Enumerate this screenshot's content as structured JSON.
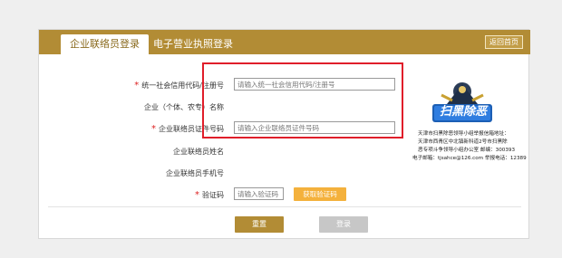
{
  "tabs": {
    "active": "企业联络员登录",
    "inactive": "电子营业执照登录",
    "back_home": "返回首页"
  },
  "form": {
    "credit_code_label": "统一社会信用代码/注册号",
    "credit_code_placeholder": "请输入统一社会信用代码/注册号",
    "enterprise_name_label": "企业（个体、农专）名称",
    "id_number_label": "企业联络员证件号码",
    "id_number_placeholder": "请输入企业联络员证件号码",
    "liaison_name_label": "企业联络员姓名",
    "liaison_phone_label": "企业联络员手机号",
    "captcha_label": "验证码",
    "captcha_placeholder": "请输入验证码",
    "get_captcha": "获取验证码",
    "required_mark": "*"
  },
  "actions": {
    "reset": "重置",
    "login": "登录"
  },
  "sidebar": {
    "logo_text": "扫黑除恶",
    "line1": "天津市扫黑除恶领导小组举报信箱地址：",
    "line2": "天津市西青区中北镇新科道2号市扫黑除",
    "line3": "恶专项斗争领导小组办公室 邮编：300393",
    "line4": "电子邮箱：tjsahce@126.com 举报电话：12389"
  },
  "colors": {
    "brand": "#b28c35",
    "accent": "#f4b13c",
    "highlight": "#e01e2a"
  }
}
